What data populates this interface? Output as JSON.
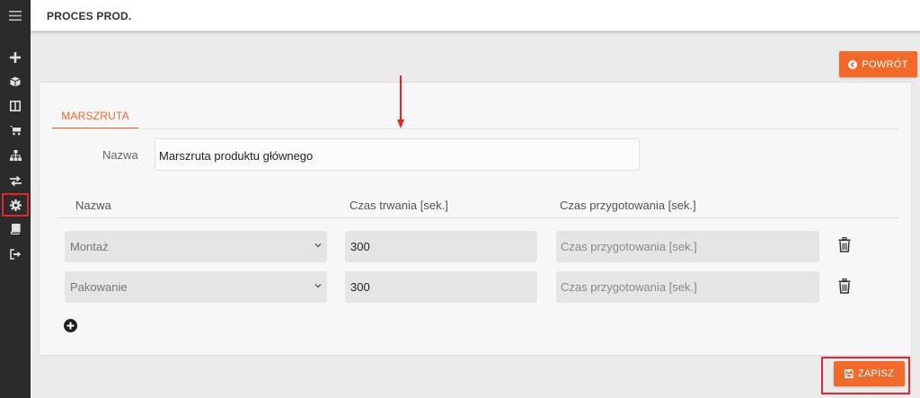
{
  "header": {
    "title": "PROCES PROD."
  },
  "sidebar": {
    "items": [
      {
        "icon": "plus-icon"
      },
      {
        "icon": "box-icon"
      },
      {
        "icon": "columns-icon"
      },
      {
        "icon": "cart-icon"
      },
      {
        "icon": "sitemap-icon"
      },
      {
        "icon": "exchange-icon"
      },
      {
        "icon": "gear-icon",
        "highlighted": true
      },
      {
        "icon": "book-icon"
      },
      {
        "icon": "sign-out-icon"
      }
    ]
  },
  "actions": {
    "back_label": "POWRÓT",
    "save_label": "ZAPISZ"
  },
  "tabs": [
    {
      "label": "MARSZRUTA",
      "active": true
    }
  ],
  "form": {
    "name_label": "Nazwa",
    "name_value": "Marszruta produktu głównego"
  },
  "table": {
    "headers": [
      "Nazwa",
      "Czas trwania [sek.]",
      "Czas przygotowania [sek.]"
    ],
    "rows": [
      {
        "operation": "Montaż",
        "duration": "300",
        "prep_placeholder": "Czas przygotowania [sek.]"
      },
      {
        "operation": "Pakowanie",
        "duration": "300",
        "prep_placeholder": "Czas przygotowania [sek.]"
      }
    ]
  },
  "colors": {
    "accent": "#f26a2b",
    "highlight": "#e5242b",
    "sidebar": "#2b2b2b"
  }
}
